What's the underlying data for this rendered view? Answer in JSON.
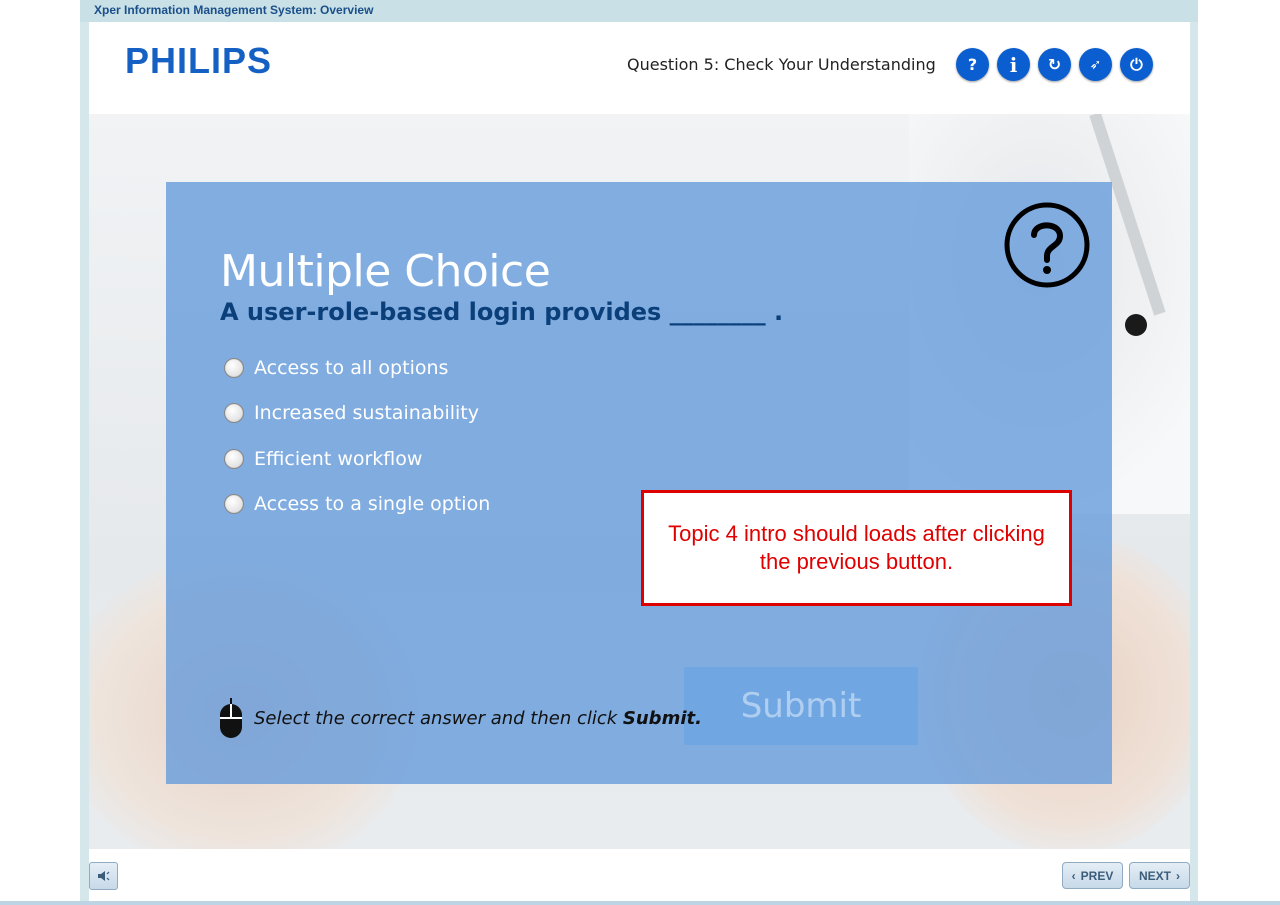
{
  "window": {
    "title": "Xper Information Management System: Overview"
  },
  "header": {
    "logo_text": "PHILIPS",
    "question_title": "Question 5: Check Your Understanding",
    "buttons": [
      {
        "name": "help",
        "icon": "question-icon",
        "glyph": "?"
      },
      {
        "name": "info",
        "icon": "info-icon",
        "glyph": "i"
      },
      {
        "name": "replay",
        "icon": "replay-icon",
        "glyph": "↻"
      },
      {
        "name": "navigate",
        "icon": "compass-icon",
        "glyph": "➶"
      },
      {
        "name": "exit",
        "icon": "power-icon",
        "glyph": "⏻"
      }
    ]
  },
  "quiz": {
    "heading": "Multiple Choice",
    "question": "A user-role-based login provides ________ .",
    "options": [
      "Access to all options",
      "Increased sustainability",
      "Efficient workflow",
      "Access to a single option"
    ],
    "submit_label": "Submit",
    "instruction_prefix": "Select the correct answer and then click ",
    "instruction_bold": "Submit."
  },
  "review_note": "Topic 4 intro should loads after clicking the previous button.",
  "footer": {
    "prev_label": "PREV",
    "next_label": "NEXT"
  },
  "colors": {
    "brand_blue": "#1561c3",
    "card_blue": "#639adb",
    "question_navy": "#0b3f7a",
    "note_red": "#e00000"
  }
}
